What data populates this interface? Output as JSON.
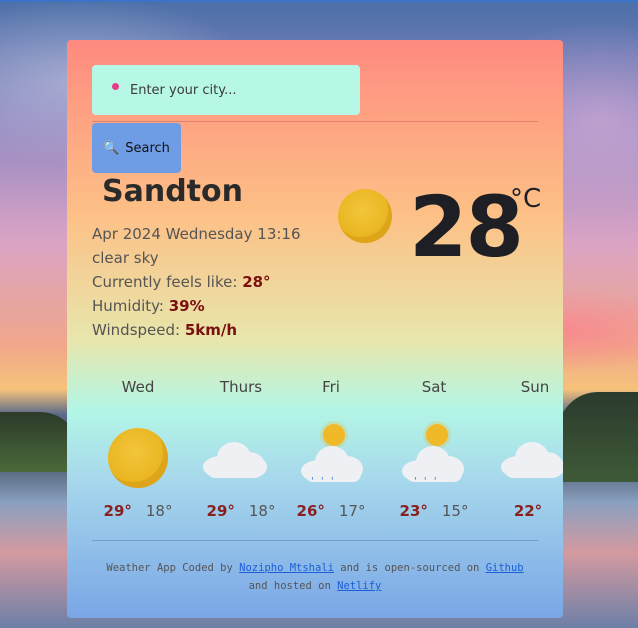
{
  "search": {
    "placeholder": "Enter your city...",
    "button_label": "Search"
  },
  "current": {
    "city": "Sandton",
    "datetime": "Apr 2024 Wednesday 13:16",
    "description": "clear sky",
    "feels_like_label": "Currently feels like: ",
    "feels_like_value": "28°",
    "humidity_label": "Humidity: ",
    "humidity_value": "39%",
    "windspeed_label": "Windspeed: ",
    "windspeed_value": "5km/h",
    "temperature": "28",
    "unit": "°C",
    "icon": "sun-icon"
  },
  "forecast": [
    {
      "day": "Wed",
      "max": "29°",
      "min": "18°",
      "icon": "sun-icon"
    },
    {
      "day": "Thurs",
      "max": "29°",
      "min": "18°",
      "icon": "cloud-icon"
    },
    {
      "day": "Fri",
      "max": "26°",
      "min": "17°",
      "icon": "sun-cloud-rain-icon"
    },
    {
      "day": "Sat",
      "max": "23°",
      "min": "15°",
      "icon": "sun-cloud-rain-icon"
    },
    {
      "day": "Sun",
      "max": "22°",
      "min": "",
      "icon": "cloud-icon"
    }
  ],
  "footer": {
    "text1": "Weather App Coded by ",
    "author": "Nozipho Mtshali",
    "text2": " and is open-sourced on ",
    "repo": "Github",
    "text3": "and hosted on ",
    "host": "Netlify"
  },
  "colors": {
    "accent_value": "#7a1010",
    "search_bg": "#b7f7e6",
    "button_bg": "#6f9de5",
    "link": "#1a5fd8"
  }
}
